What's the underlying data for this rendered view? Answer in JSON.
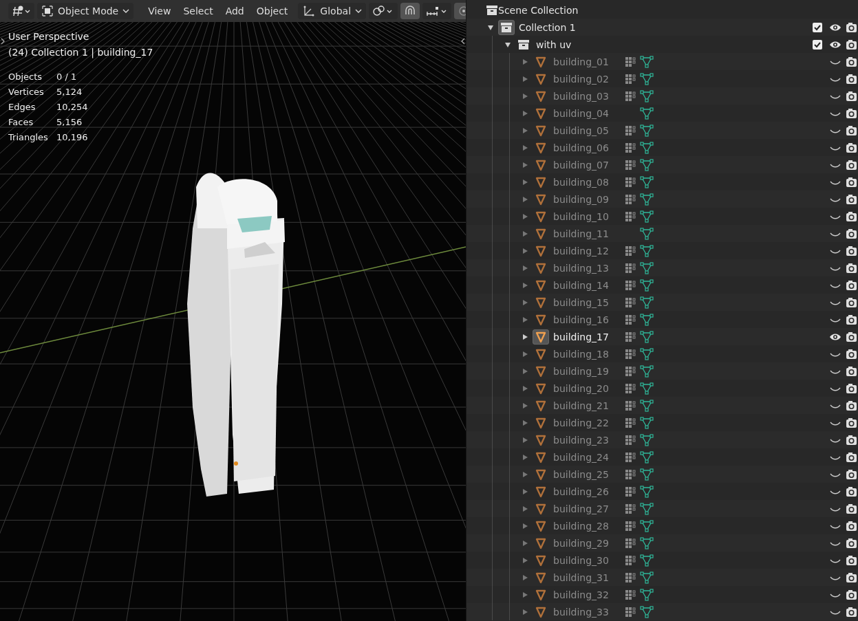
{
  "viewport": {
    "header": {
      "mode": "Object Mode",
      "menus": [
        "View",
        "Select",
        "Add",
        "Object"
      ],
      "orientation": "Global",
      "snap_on": true
    },
    "overlay": {
      "view_name": "User Perspective",
      "context": "(24) Collection 1 | building_17",
      "stats": [
        {
          "label": "Objects",
          "value": "0 / 1"
        },
        {
          "label": "Vertices",
          "value": "5,124"
        },
        {
          "label": "Edges",
          "value": "10,254"
        },
        {
          "label": "Faces",
          "value": "5,156"
        },
        {
          "label": "Triangles",
          "value": "10,196"
        }
      ]
    }
  },
  "outliner": {
    "root": {
      "label": "Scene Collection",
      "children": [
        {
          "label": "Collection 1",
          "expanded": true,
          "active": true,
          "checked": true,
          "visible": true,
          "children": [
            {
              "label": "with uv",
              "expanded": true,
              "active": false,
              "checked": true,
              "visible": true,
              "objects": [
                {
                  "name": "building_01",
                  "has_modifier": true,
                  "visible": false,
                  "active": false
                },
                {
                  "name": "building_02",
                  "has_modifier": true,
                  "visible": false,
                  "active": false
                },
                {
                  "name": "building_03",
                  "has_modifier": true,
                  "visible": false,
                  "active": false
                },
                {
                  "name": "building_04",
                  "has_modifier": false,
                  "visible": false,
                  "active": false
                },
                {
                  "name": "building_05",
                  "has_modifier": true,
                  "visible": false,
                  "active": false
                },
                {
                  "name": "building_06",
                  "has_modifier": true,
                  "visible": false,
                  "active": false
                },
                {
                  "name": "building_07",
                  "has_modifier": true,
                  "visible": false,
                  "active": false
                },
                {
                  "name": "building_08",
                  "has_modifier": true,
                  "visible": false,
                  "active": false
                },
                {
                  "name": "building_09",
                  "has_modifier": true,
                  "visible": false,
                  "active": false
                },
                {
                  "name": "building_10",
                  "has_modifier": true,
                  "visible": false,
                  "active": false
                },
                {
                  "name": "building_11",
                  "has_modifier": false,
                  "visible": false,
                  "active": false
                },
                {
                  "name": "building_12",
                  "has_modifier": true,
                  "visible": false,
                  "active": false
                },
                {
                  "name": "building_13",
                  "has_modifier": true,
                  "visible": false,
                  "active": false
                },
                {
                  "name": "building_14",
                  "has_modifier": true,
                  "visible": false,
                  "active": false
                },
                {
                  "name": "building_15",
                  "has_modifier": true,
                  "visible": false,
                  "active": false
                },
                {
                  "name": "building_16",
                  "has_modifier": true,
                  "visible": false,
                  "active": false
                },
                {
                  "name": "building_17",
                  "has_modifier": true,
                  "visible": true,
                  "active": true
                },
                {
                  "name": "building_18",
                  "has_modifier": true,
                  "visible": false,
                  "active": false
                },
                {
                  "name": "building_19",
                  "has_modifier": true,
                  "visible": false,
                  "active": false
                },
                {
                  "name": "building_20",
                  "has_modifier": true,
                  "visible": false,
                  "active": false
                },
                {
                  "name": "building_21",
                  "has_modifier": true,
                  "visible": false,
                  "active": false
                },
                {
                  "name": "building_22",
                  "has_modifier": true,
                  "visible": false,
                  "active": false
                },
                {
                  "name": "building_23",
                  "has_modifier": true,
                  "visible": false,
                  "active": false
                },
                {
                  "name": "building_24",
                  "has_modifier": true,
                  "visible": false,
                  "active": false
                },
                {
                  "name": "building_25",
                  "has_modifier": true,
                  "visible": false,
                  "active": false
                },
                {
                  "name": "building_26",
                  "has_modifier": true,
                  "visible": false,
                  "active": false
                },
                {
                  "name": "building_27",
                  "has_modifier": true,
                  "visible": false,
                  "active": false
                },
                {
                  "name": "building_28",
                  "has_modifier": true,
                  "visible": false,
                  "active": false
                },
                {
                  "name": "building_29",
                  "has_modifier": true,
                  "visible": false,
                  "active": false
                },
                {
                  "name": "building_30",
                  "has_modifier": true,
                  "visible": false,
                  "active": false
                },
                {
                  "name": "building_31",
                  "has_modifier": true,
                  "visible": false,
                  "active": false
                },
                {
                  "name": "building_32",
                  "has_modifier": true,
                  "visible": false,
                  "active": false
                },
                {
                  "name": "building_33",
                  "has_modifier": true,
                  "visible": false,
                  "active": false
                }
              ]
            }
          ]
        }
      ]
    }
  }
}
